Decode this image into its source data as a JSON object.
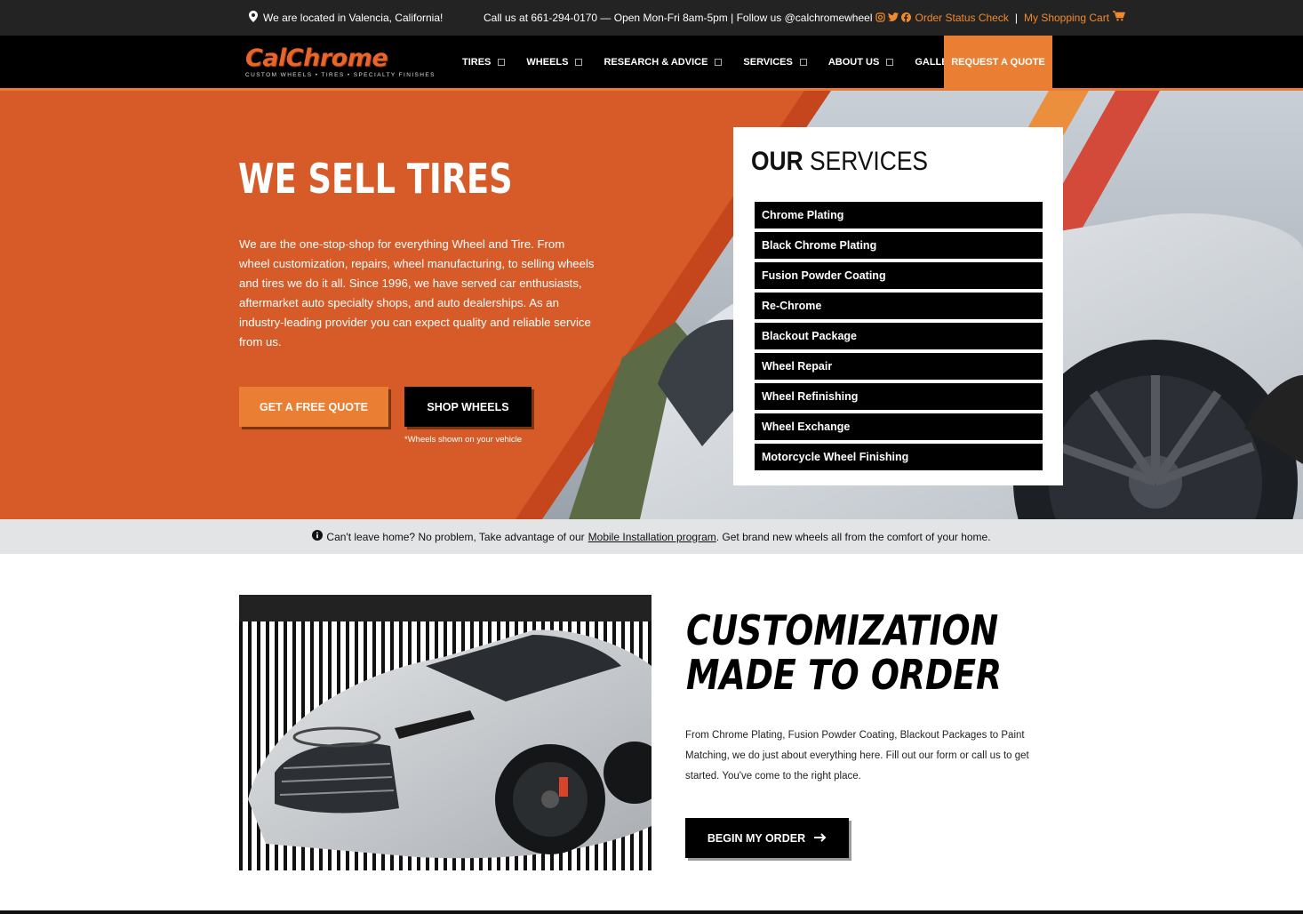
{
  "topbar": {
    "location": "We are located in Valencia, California!",
    "contact": "Call us at 661-294-0170 — Open Mon-Fri 8am-5pm | Follow us @calchromewheel",
    "order_status": "Order Status Check",
    "separator": "|",
    "cart": "My Shopping Cart"
  },
  "logo": {
    "brand": "CalChrome",
    "tagline": "CUSTOM WHEELS • TIRES • SPECIALTY FINISHES"
  },
  "nav": {
    "items": [
      {
        "label": "TIRES"
      },
      {
        "label": "WHEELS"
      },
      {
        "label": "RESEARCH & ADVICE"
      },
      {
        "label": "SERVICES"
      },
      {
        "label": "ABOUT US"
      },
      {
        "label": "GALLERY"
      }
    ],
    "quote_button": "REQUEST A QUOTE"
  },
  "hero": {
    "title": "WE SELL TIRES",
    "description": "We are the one-stop-shop for everything Wheel and Tire. From wheel customization, repairs, wheel manufacturing, to selling wheels and tires we do it all. Since 1996, we have served car enthusiasts, aftermarket auto specialty shops, and auto dealerships. As an industry-leading provider you can expect quality and reliable service from us.",
    "btn_quote": "GET A FREE QUOTE",
    "btn_shop": "SHOP WHEELS",
    "note": "*Wheels shown on your vehicle"
  },
  "services": {
    "title_bold": "OUR",
    "title_rest": "SERVICES",
    "items": [
      "Chrome Plating",
      "Black Chrome Plating",
      "Fusion Powder Coating",
      "Re-Chrome",
      "Blackout Package",
      "Wheel Repair",
      "Wheel Refinishing",
      "Wheel Exchange",
      "Motorcycle Wheel Finishing"
    ]
  },
  "notice": {
    "before": "Can't leave home? No problem, Take advantage of our",
    "link": "Mobile Installation program",
    "after": ". Get brand new wheels all from the comfort of your home."
  },
  "custom": {
    "title": "CUSTOMIZATION MADE TO ORDER",
    "description": "From Chrome Plating, Fusion Powder Coating, Blackout Packages to Paint Matching, we do just about everything here. Fill out our form or call us to get started. You've come to the right place.",
    "button": "BEGIN MY ORDER"
  },
  "colors": {
    "accent": "#ea7f33",
    "hero_bg": "#d65b28",
    "dark": "#000000"
  },
  "icons": [
    "map-pin-icon",
    "instagram-icon",
    "twitter-icon",
    "facebook-icon",
    "cart-icon",
    "info-icon",
    "arrow-right-icon"
  ]
}
